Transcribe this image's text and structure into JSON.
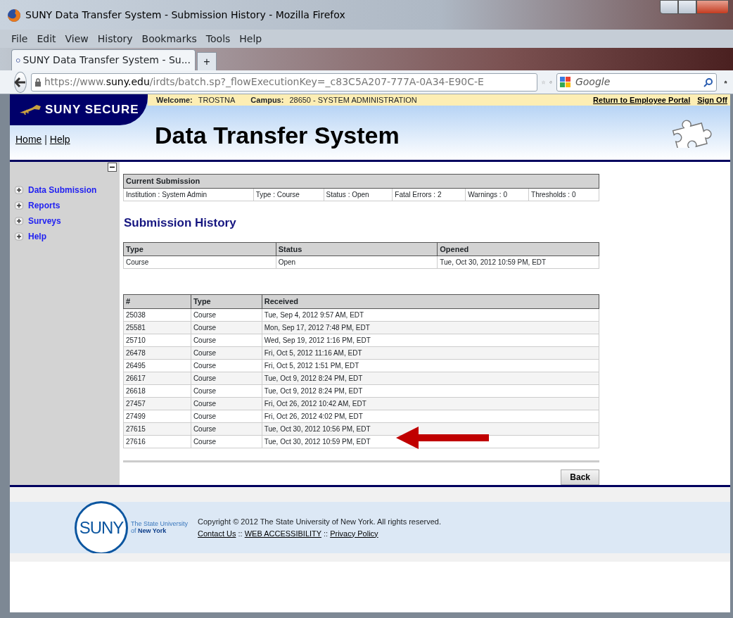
{
  "window": {
    "title": "SUNY Data Transfer System - Submission History - Mozilla Firefox"
  },
  "menu": [
    "File",
    "Edit",
    "View",
    "History",
    "Bookmarks",
    "Tools",
    "Help"
  ],
  "tab": {
    "title": "SUNY Data Transfer System - Su...",
    "new_tab": "+"
  },
  "address_bar": {
    "url_prefix": "https://www.",
    "url_domain": "suny.edu",
    "url_rest": "/irdts/batch.sp?_flowExecutionKey=_c83C5A207-777A-0A34-E90C-E"
  },
  "search": {
    "placeholder": "Google"
  },
  "header": {
    "logo": "SUNY SECURE",
    "welcome_label": "Welcome:",
    "user": "TROSTNA",
    "campus_label": "Campus:",
    "campus": "28650 - SYSTEM ADMINISTRATION",
    "links": [
      "Return to Employee Portal",
      "Sign Off"
    ],
    "nav_links": [
      "Home",
      "Help"
    ],
    "nav_separator": "|",
    "title": "Data Transfer System"
  },
  "sidebar": {
    "items": [
      {
        "label": "Data Submission",
        "expanded": false
      },
      {
        "label": "Reports",
        "expanded": false
      },
      {
        "label": "Surveys",
        "expanded": false
      },
      {
        "label": "Help",
        "expanded": false
      }
    ]
  },
  "current_submission": {
    "title": "Current Submission",
    "cells": [
      "Institution : System Admin",
      "Type : Course",
      "Status : Open",
      "Fatal Errors : 2",
      "Warnings : 0",
      "Thresholds : 0"
    ]
  },
  "heading": "Submission History",
  "open_table": {
    "columns": [
      "Type",
      "Status",
      "Opened"
    ],
    "rows": [
      [
        "Course",
        "Open",
        "Tue, Oct 30, 2012 10:59 PM, EDT"
      ]
    ]
  },
  "history_table": {
    "columns": [
      "#",
      "Type",
      "Received"
    ],
    "rows": [
      [
        "25038",
        "Course",
        "Tue, Sep 4, 2012 9:57 AM, EDT"
      ],
      [
        "25581",
        "Course",
        "Mon, Sep 17, 2012 7:48 PM, EDT"
      ],
      [
        "25710",
        "Course",
        "Wed, Sep 19, 2012 1:16 PM, EDT"
      ],
      [
        "26478",
        "Course",
        "Fri, Oct 5, 2012 11:16 AM, EDT"
      ],
      [
        "26495",
        "Course",
        "Fri, Oct 5, 2012 1:51 PM, EDT"
      ],
      [
        "26617",
        "Course",
        "Tue, Oct 9, 2012 8:24 PM, EDT"
      ],
      [
        "26618",
        "Course",
        "Tue, Oct 9, 2012 8:24 PM, EDT"
      ],
      [
        "27457",
        "Course",
        "Fri, Oct 26, 2012 10:42 AM, EDT"
      ],
      [
        "27499",
        "Course",
        "Fri, Oct 26, 2012 4:02 PM, EDT"
      ],
      [
        "27615",
        "Course",
        "Tue, Oct 30, 2012 10:56 PM, EDT"
      ],
      [
        "27616",
        "Course",
        "Tue, Oct 30, 2012 10:59 PM, EDT"
      ]
    ]
  },
  "back_button": "Back",
  "footer": {
    "logo": "SUNY",
    "tagline_1": "The State University",
    "tagline_2": "of **New York**",
    "copyright": "Copyright © 2012 The State University of New York. All rights reserved.",
    "links": [
      "Contact Us",
      "WEB ACCESSIBILITY",
      "Privacy Policy"
    ],
    "link_separator": "::"
  }
}
